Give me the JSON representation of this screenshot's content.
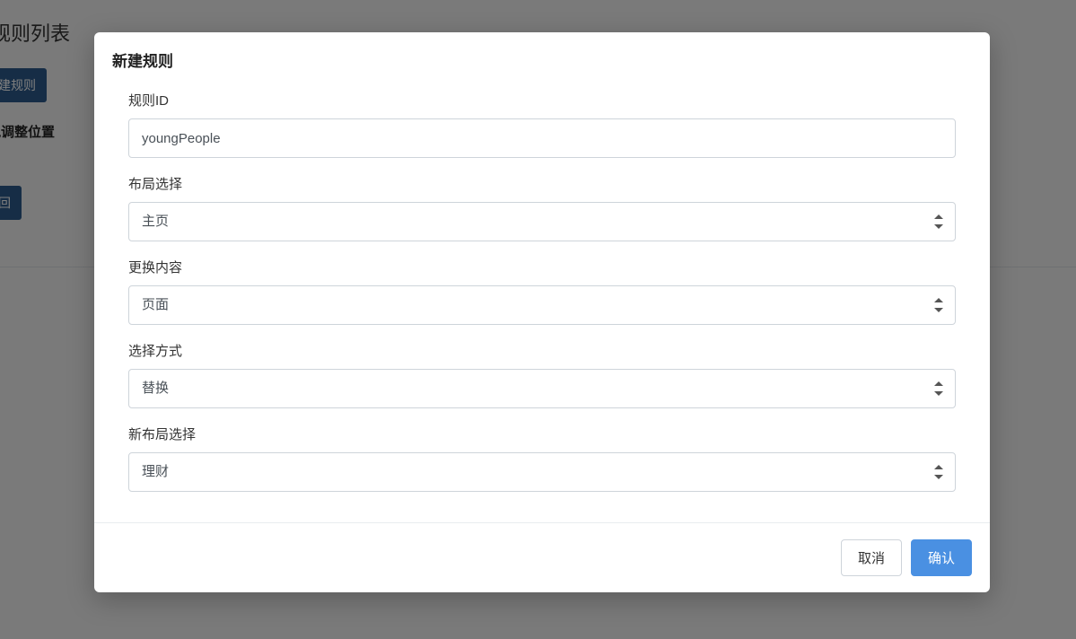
{
  "background": {
    "page_title_suffix": "规则列表",
    "create_rule_button_suffix": "建规则",
    "drag_hint_suffix": "拽调整位置",
    "return_button_suffix": "回"
  },
  "modal": {
    "title": "新建规则",
    "fields": {
      "rule_id": {
        "label": "规则ID",
        "value": "youngPeople"
      },
      "layout_select": {
        "label": "布局选择",
        "value": "主页"
      },
      "change_content": {
        "label": "更换内容",
        "value": "页面"
      },
      "select_method": {
        "label": "选择方式",
        "value": "替换"
      },
      "new_layout_select": {
        "label": "新布局选择",
        "value": "理财"
      }
    },
    "footer": {
      "cancel": "取消",
      "confirm": "确认"
    }
  }
}
